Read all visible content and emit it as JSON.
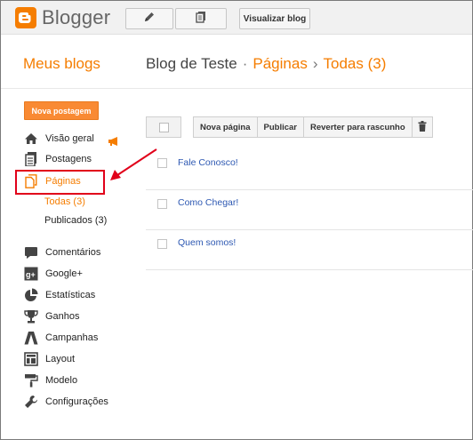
{
  "app": {
    "name": "Blogger"
  },
  "topbar": {
    "edit_icon": "pencil-icon",
    "pages_icon": "copy-icon",
    "view_blog_label": "Visualizar blog"
  },
  "header": {
    "my_blogs": "Meus blogs",
    "blog_name": "Blog de Teste",
    "section": "Páginas",
    "filter": "Todas (3)",
    "sep1": "·",
    "sep2": "›"
  },
  "sidebar": {
    "new_post_label": "Nova postagem",
    "items": [
      {
        "label": "Visão geral",
        "icon": "home-icon"
      },
      {
        "label": "Postagens",
        "icon": "posts-icon"
      },
      {
        "label": "Páginas",
        "icon": "pages-icon"
      },
      {
        "label": "Comentários",
        "icon": "comment-icon"
      },
      {
        "label": "Google+",
        "icon": "google-plus-icon"
      },
      {
        "label": "Estatísticas",
        "icon": "pie-chart-icon"
      },
      {
        "label": "Ganhos",
        "icon": "trophy-icon"
      },
      {
        "label": "Campanhas",
        "icon": "campaign-icon"
      },
      {
        "label": "Layout",
        "icon": "layout-icon"
      },
      {
        "label": "Modelo",
        "icon": "paint-roller-icon"
      },
      {
        "label": "Configurações",
        "icon": "wrench-icon"
      }
    ],
    "pages_sub": {
      "all": "Todas (3)",
      "published": "Publicados (3)"
    }
  },
  "toolbar": {
    "new_page": "Nova página",
    "publish": "Publicar",
    "revert": "Reverter para rascunho",
    "delete_icon": "trash-icon"
  },
  "pages": [
    {
      "title": "Fale Conosco!"
    },
    {
      "title": "Como Chegar!"
    },
    {
      "title": "Quem somos!"
    }
  ],
  "colors": {
    "accent": "#f57d00",
    "link": "#2d58b2",
    "highlight": "#e1001a"
  }
}
